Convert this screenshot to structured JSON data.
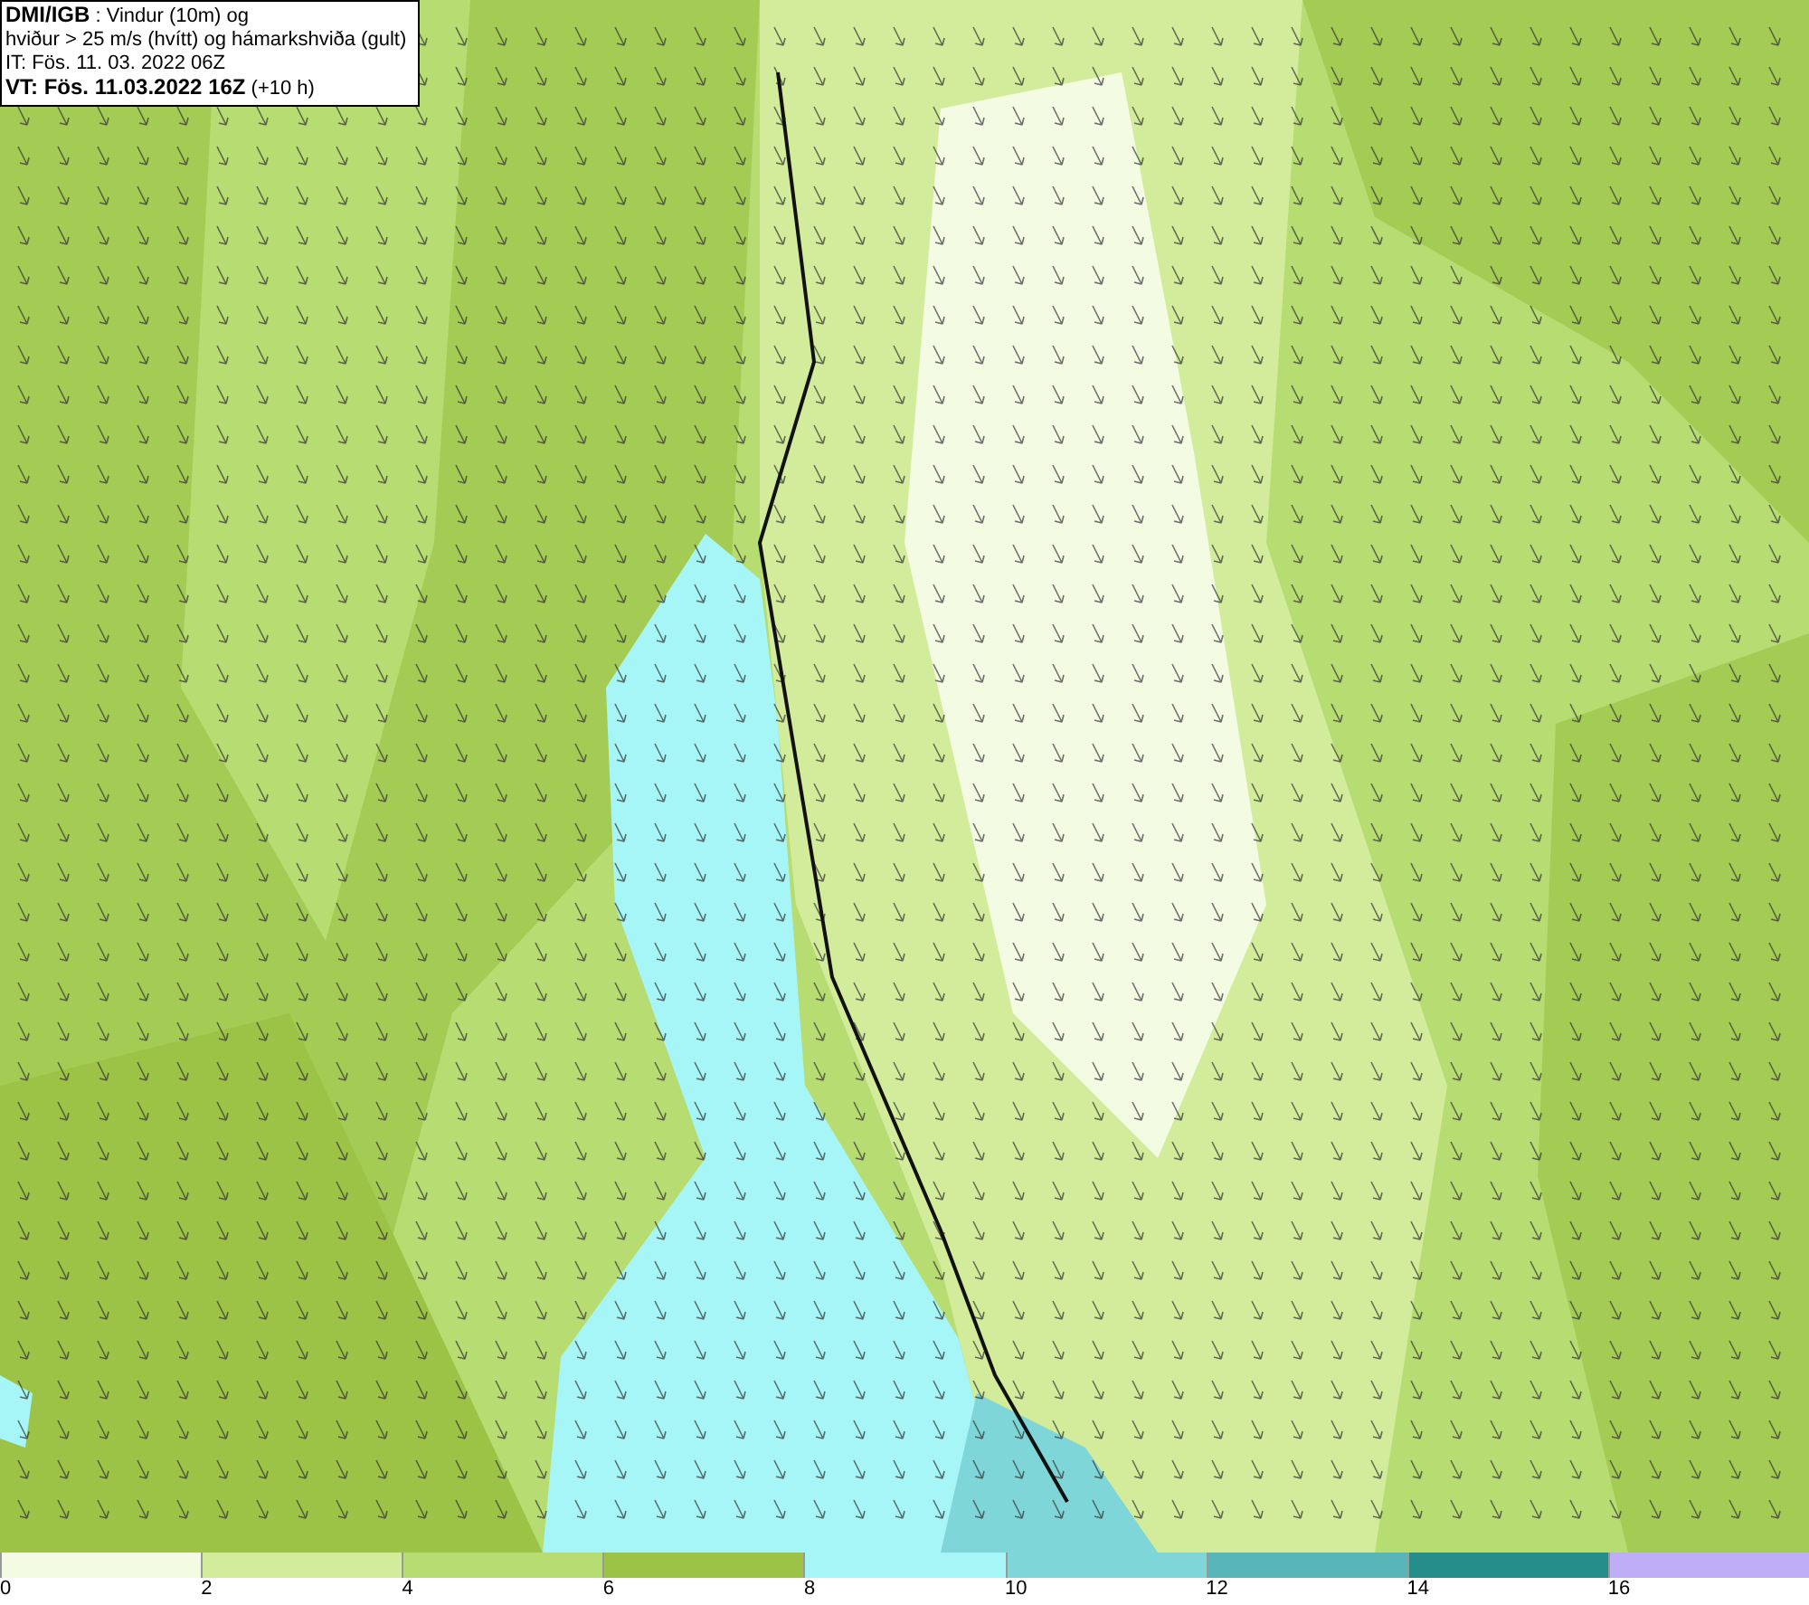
{
  "title_box": {
    "lines": [
      "**DMI/IGB** : Vindur (10m) og",
      "hviður > 25 m/s (hvítt) og hámarkshviða (gult)",
      "IT: Fös. 11. 03. 2022 06Z",
      "**VT: Fös. 11.03.2022 16Z** (+10 h)"
    ]
  },
  "legend": [
    {
      "label": "0",
      "color": "#f4fbe3"
    },
    {
      "label": "2",
      "color": "#d3ec9b"
    },
    {
      "label": "4",
      "color": "#b7dc72"
    },
    {
      "label": "6",
      "color": "#9cc246"
    },
    {
      "label": "8",
      "color": "#a6f6f8"
    },
    {
      "label": "10",
      "color": "#7fd6d8"
    },
    {
      "label": "12",
      "color": "#58b6b8"
    },
    {
      "label": "14",
      "color": "#258e8a"
    },
    {
      "label": "16",
      "color": "#bdaef5"
    }
  ]
}
